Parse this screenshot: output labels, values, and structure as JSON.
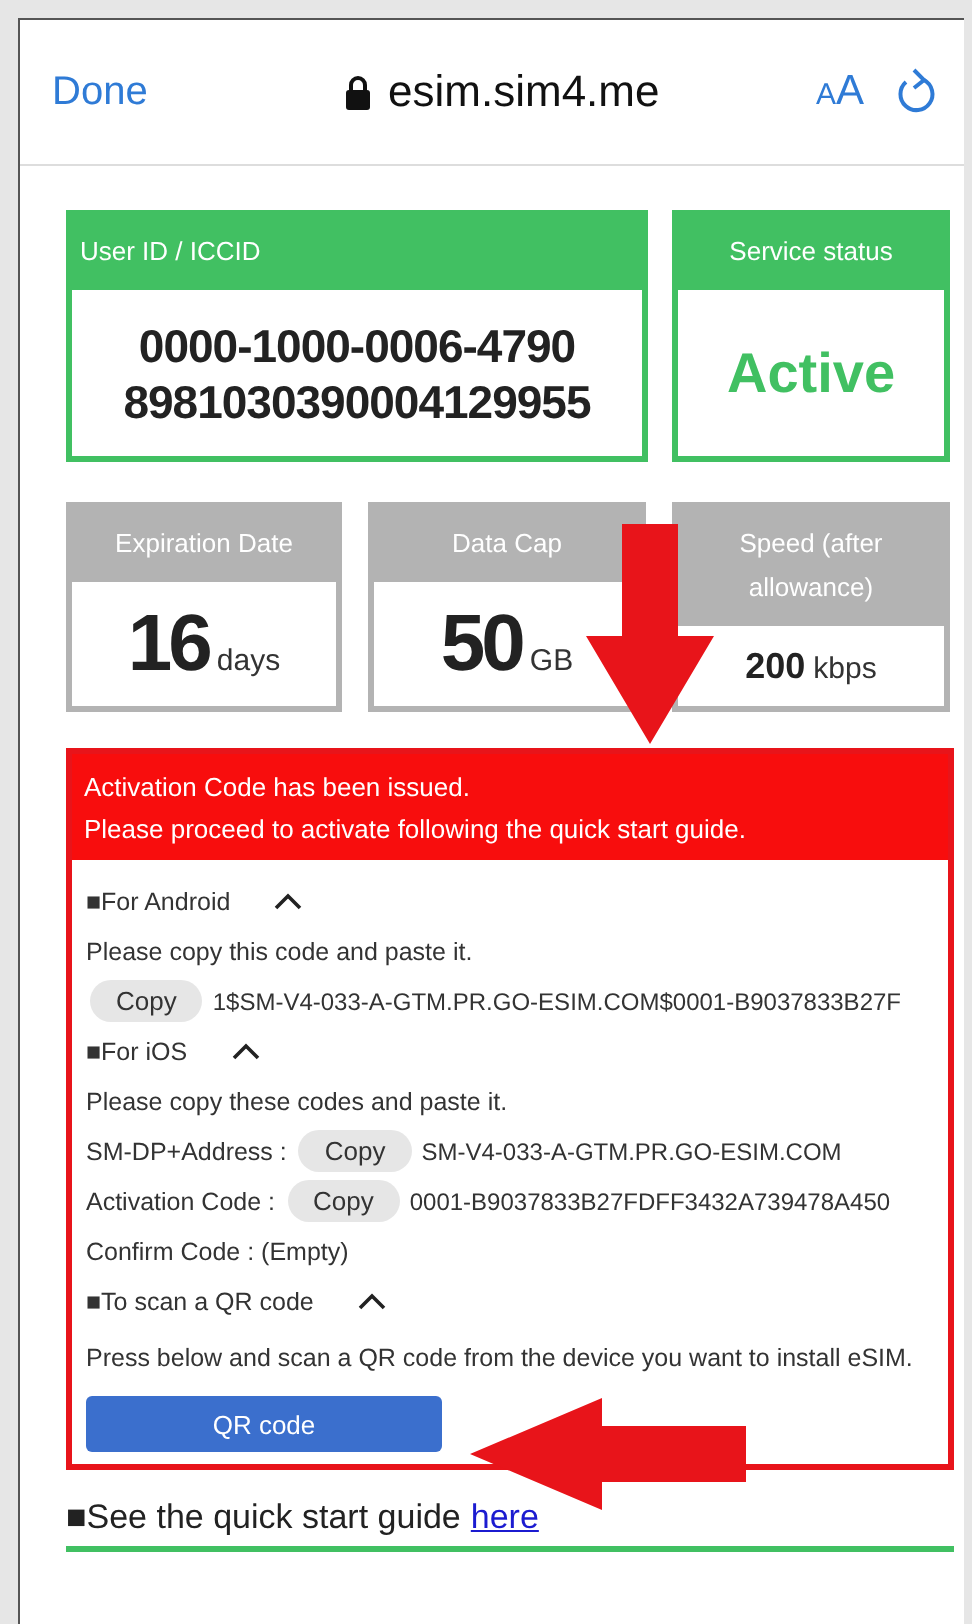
{
  "browser": {
    "done": "Done",
    "url": "esim.sim4.me",
    "text_size": "AA"
  },
  "top_cards": [
    {
      "kind": "id",
      "label": "User ID / ICCID",
      "lines": [
        "0000-1000-0006-4790",
        "8981030390004129955"
      ]
    },
    {
      "kind": "status",
      "label": "Service status",
      "value": "Active"
    }
  ],
  "stat_cards": [
    {
      "label": "Expiration Date",
      "value": "16",
      "unit": "days"
    },
    {
      "label": "Data Cap",
      "value": "50",
      "unit": "GB"
    },
    {
      "label": "Speed (after allowance)",
      "value": "200",
      "unit": "kbps"
    }
  ],
  "activation": {
    "notice_lines": [
      "Activation Code has been issued.",
      "Please proceed to activate following the quick start guide."
    ],
    "sections": [
      {
        "title": "■For Android",
        "expanded": true,
        "rows": [
          {
            "kind": "text",
            "text": "Please copy this code and paste it."
          },
          {
            "kind": "copy",
            "button": "Copy",
            "value": "1$SM-V4-033-A-GTM.PR.GO-ESIM.COM$0001-B9037833B27F"
          }
        ]
      },
      {
        "title": "■For iOS",
        "expanded": true,
        "rows": [
          {
            "kind": "text",
            "text": "Please copy these codes and paste it."
          },
          {
            "kind": "copy",
            "label": "SM-DP+Address :",
            "button": "Copy",
            "value": "SM-V4-033-A-GTM.PR.GO-ESIM.COM"
          },
          {
            "kind": "copy",
            "label": "Activation Code :",
            "button": "Copy",
            "value": "0001-B9037833B27FDFF3432A739478A450"
          },
          {
            "kind": "text",
            "text": "Confirm Code : (Empty)"
          }
        ]
      },
      {
        "title": "■To scan a QR code",
        "expanded": true,
        "rows": [
          {
            "kind": "text",
            "text": "Press below and scan a QR code from the device you want to install eSIM."
          },
          {
            "kind": "button",
            "button": "QR code"
          }
        ]
      }
    ]
  },
  "guide": {
    "text": "■See the quick start guide",
    "link": "here"
  }
}
